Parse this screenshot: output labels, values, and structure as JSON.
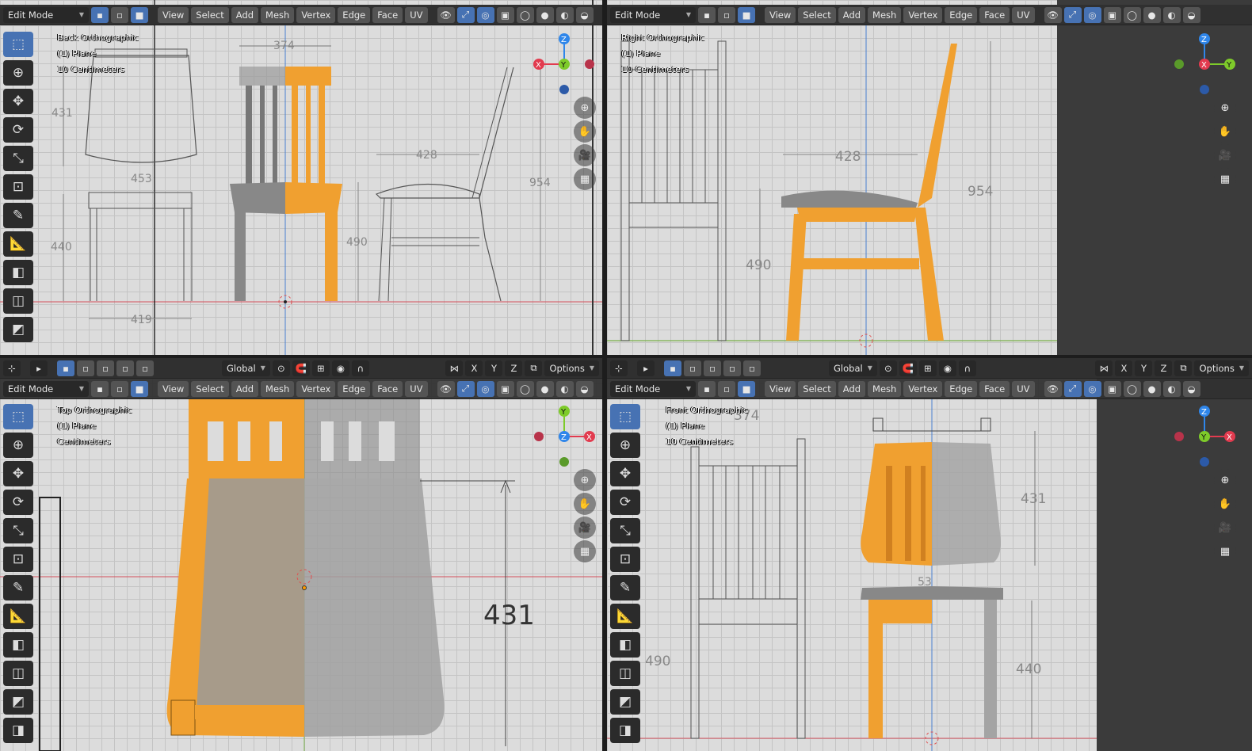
{
  "header": {
    "mode": "Edit Mode",
    "menus": [
      "View",
      "Select",
      "Add",
      "Mesh",
      "Vertex",
      "Edge",
      "Face",
      "UV"
    ],
    "transform": "Global",
    "options": "Options"
  },
  "axes": {
    "x": "X",
    "y": "Y",
    "z": "Z"
  },
  "viewports": {
    "back": {
      "title": "Back Orthographic",
      "object": "(1) Plane",
      "scale": "10 Centimeters"
    },
    "right": {
      "title": "Right Orthographic",
      "object": "(1) Plane",
      "scale": "10 Centimeters"
    },
    "top": {
      "title": "Top Orthographic",
      "object": "(1) Plane",
      "scale": "Centimeters"
    },
    "front": {
      "title": "Front Orthographic",
      "object": "(1) Plane",
      "scale": "10 Centimeters"
    }
  },
  "dimensions": {
    "back": [
      "374",
      "431",
      "453",
      "428",
      "954",
      "440",
      "490",
      "419"
    ],
    "right": [
      "428",
      "954",
      "490"
    ],
    "top": [
      "431"
    ],
    "front": [
      "374",
      "431",
      "440",
      "490",
      "53"
    ]
  },
  "colors": {
    "selection": "#f0a030",
    "x_axis": "#e23b4f",
    "y_axis": "#7ecb2a",
    "z_axis": "#2f86ea",
    "active_tool": "#4772b3"
  },
  "icons": {
    "tools": [
      "select-box",
      "cursor",
      "move",
      "rotate",
      "scale",
      "transform",
      "annotate",
      "measure",
      "extrude",
      "inset",
      "bevel",
      "loop-cut"
    ],
    "nav": [
      "zoom-in",
      "hand-pan",
      "camera",
      "grid"
    ]
  }
}
